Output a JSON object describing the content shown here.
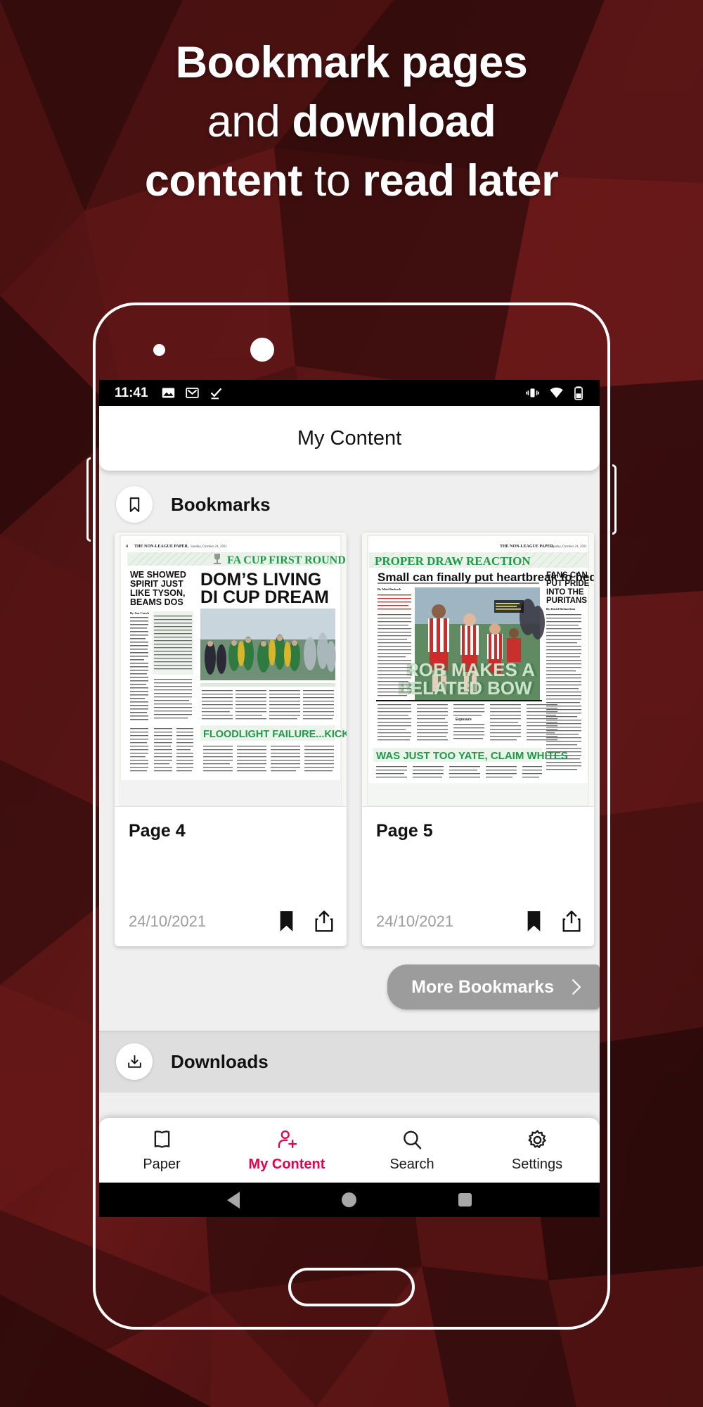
{
  "promo": {
    "line1_bold": "Bookmark pages",
    "line2_light": "and ",
    "line2_bold": "download",
    "line3_bold": "content ",
    "line3_light": "to ",
    "line3_bold2": "read later"
  },
  "colors": {
    "background_dark": "#2b0a0a",
    "background_mid": "#5d1414",
    "accent_pink": "#E4004F",
    "app_background": "#efefef",
    "button_gray": "#9c9c9c",
    "date_gray": "#9d9d9d",
    "newsprint_green": "#1f9a46"
  },
  "statusbar": {
    "time": "11:41",
    "left_icons": [
      "image-icon",
      "gmail-icon",
      "checkmark-icon"
    ],
    "right_icons": [
      "vibrate-icon",
      "wifi-icon",
      "battery-icon"
    ]
  },
  "appbar": {
    "title": "My Content"
  },
  "sections": {
    "bookmarks": {
      "icon": "bookmark-icon",
      "title": "Bookmarks"
    },
    "downloads": {
      "icon": "download-icon",
      "title": "Downloads"
    }
  },
  "cards": [
    {
      "page_label": "Page 4",
      "date": "24/10/2021",
      "bookmark_icon": "bookmark-filled-icon",
      "share_icon": "share-icon",
      "thumbnail": {
        "masthead": "THE NON-LEAGUE PAPER,  Sunday, October 24, 2021",
        "folio": "4",
        "banner": "FA CUP FIRST ROUND",
        "headline_left": "WE SHOWED SPIRIT JUST LIKE TYSON, BEAMS DOS",
        "headline_main": "DOM'S LIVING DI CUP DREAM",
        "byline": "By Jon Couch",
        "strapline": "LET THE CUP DRAW BEGIN! Dom's boys celebrate their win over Lowestoft during Saturday's tie",
        "sub_headline": "FLOODLIGHT FAILURE...KICK-OFF"
      }
    },
    {
      "page_label": "Page 5",
      "date": "24/10/2021",
      "bookmark_icon": "bookmark-filled-icon",
      "share_icon": "share-icon",
      "thumbnail": {
        "masthead": "THE NON-LEAGUE PAPER,  Sunday, October 24, 2021",
        "banner": "PROPER DRAW REACTION",
        "headline_main": "Small can finally put heartbreak to bed",
        "headline_right": "FANS CAN PUT PRIDE INTO THE PURITANS",
        "byline": "By Matt Badcock",
        "byline_right": "By David Richardson",
        "overlay_headline": "ROB MAKES A BELATED BOW",
        "pull_quote": "Exposure",
        "sub_headline": "WAS JUST TOO YATE, CLAIM WHITES"
      }
    }
  ],
  "more_button": {
    "label": "More Bookmarks",
    "icon": "chevron-right-icon"
  },
  "bottom_nav": [
    {
      "label": "Paper",
      "icon": "paper-icon",
      "active": false
    },
    {
      "label": "My Content",
      "icon": "my-content-icon",
      "active": true
    },
    {
      "label": "Search",
      "icon": "search-icon",
      "active": false
    },
    {
      "label": "Settings",
      "icon": "settings-gear-icon",
      "active": false
    }
  ],
  "android_nav": [
    "back-icon",
    "home-icon",
    "recents-icon"
  ]
}
